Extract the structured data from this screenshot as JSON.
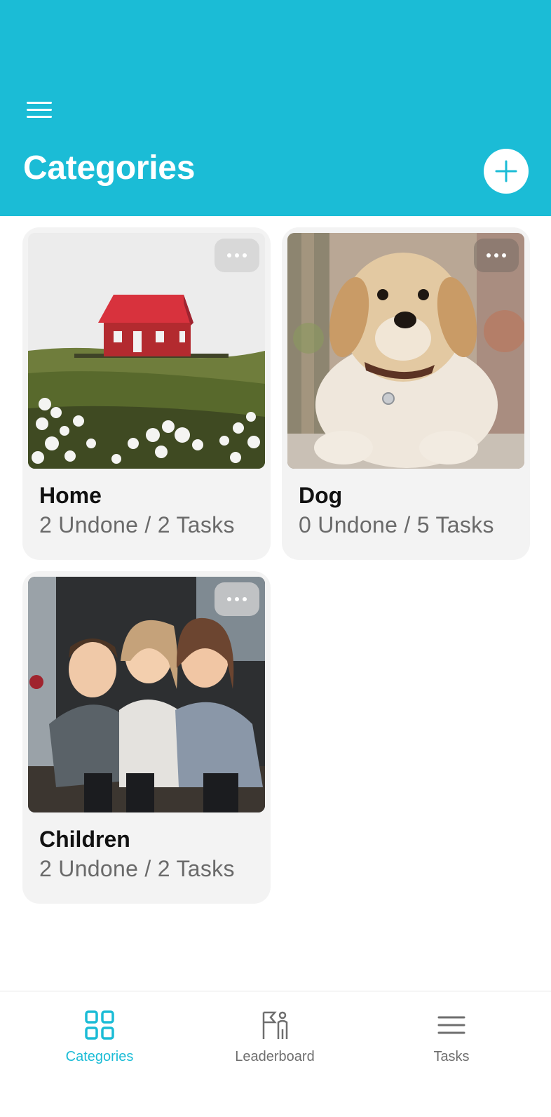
{
  "header": {
    "title": "Categories",
    "menu_icon": "hamburger-menu-icon",
    "add_icon": "plus-icon",
    "background_color": "#1bbcd6"
  },
  "categories": [
    {
      "name": "Home",
      "stats": "2 Undone / 2 Tasks",
      "image": "red-house-on-hill"
    },
    {
      "name": "Dog",
      "stats": "0 Undone / 5 Tasks",
      "image": "golden-retriever-puppy"
    },
    {
      "name": "Children",
      "stats": "2 Undone / 2 Tasks",
      "image": "three-laughing-children"
    }
  ],
  "bottom_nav": {
    "items": [
      {
        "label": "Categories",
        "icon": "grid-icon",
        "active": true
      },
      {
        "label": "Leaderboard",
        "icon": "leaderboard-icon",
        "active": false
      },
      {
        "label": "Tasks",
        "icon": "list-icon",
        "active": false
      }
    ],
    "active_color": "#1bbcd6",
    "inactive_color": "#6e6e6e"
  }
}
